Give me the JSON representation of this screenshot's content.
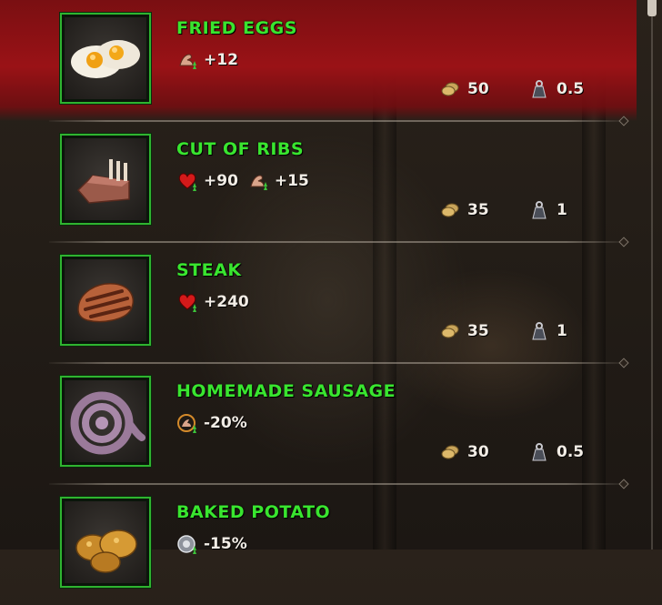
{
  "items": [
    {
      "name": "FRIED EGGS",
      "image_icon": "fried-eggs-icon",
      "stats": [
        {
          "icon": "stamina-boost-icon",
          "value": "+12"
        }
      ],
      "price": "50",
      "weight": "0.5",
      "selected": true
    },
    {
      "name": "CUT OF RIBS",
      "image_icon": "ribs-icon",
      "stats": [
        {
          "icon": "health-boost-icon",
          "value": "+90"
        },
        {
          "icon": "stamina-boost-icon",
          "value": "+15"
        }
      ],
      "price": "35",
      "weight": "1",
      "selected": false
    },
    {
      "name": "STEAK",
      "image_icon": "steak-icon",
      "stats": [
        {
          "icon": "health-boost-icon",
          "value": "+240"
        }
      ],
      "price": "35",
      "weight": "1",
      "selected": false
    },
    {
      "name": "HOMEMADE SAUSAGE",
      "image_icon": "sausage-icon",
      "stats": [
        {
          "icon": "stamina-regen-icon",
          "value": "-20%"
        }
      ],
      "price": "30",
      "weight": "0.5",
      "selected": false
    },
    {
      "name": "BAKED POTATO",
      "image_icon": "potato-icon",
      "stats": [
        {
          "icon": "resist-icon",
          "value": "-15%"
        }
      ],
      "price": "",
      "weight": "",
      "selected": false
    }
  ],
  "currency_icon": "coin-icon",
  "weight_icon": "weight-icon",
  "colors": {
    "selected_row": "#9a1216",
    "item_name": "#39e52f",
    "thumb_border": "#2fb430",
    "text": "#f2ede6"
  }
}
